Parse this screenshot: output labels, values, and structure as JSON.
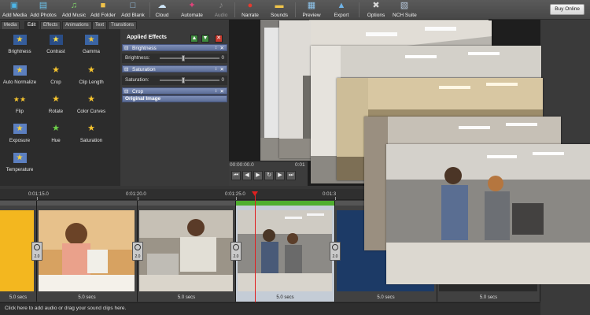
{
  "toolbar": {
    "add_media": "Add Media",
    "add_photos": "Add Photos",
    "add_music": "Add Music",
    "add_folder": "Add Folder",
    "add_blank": "Add Blank",
    "cloud": "Cloud",
    "automate": "Automate",
    "audio": "Audio",
    "narrate": "Narrate",
    "sounds": "Sounds",
    "preview": "Preview",
    "export": "Export",
    "options": "Options",
    "nch_suite": "NCH Suite",
    "buy_online": "Buy Online"
  },
  "tabs": [
    "Media",
    "Edit",
    "Effects",
    "Animations",
    "Text",
    "Transitions"
  ],
  "effects": {
    "brightness": "Brightness",
    "contrast": "Contrast",
    "gamma": "Gamma",
    "auto_normalize": "Auto Normalize",
    "crop": "Crop",
    "clip_length": "Clip Length",
    "flip": "Flip",
    "rotate": "Rotate",
    "color_curves": "Color Curves",
    "exposure": "Exposure",
    "hue": "Hue",
    "saturation": "Saturation",
    "temperature": "Temperature"
  },
  "applied_effects": {
    "title": "Applied Effects",
    "brightness": {
      "name": "Brightness",
      "param": "Brightness:",
      "value": "0"
    },
    "saturation": {
      "name": "Saturation",
      "param": "Saturation:",
      "value": "0"
    },
    "crop": {
      "name": "Crop"
    },
    "original": "Original Image"
  },
  "preview": {
    "time": "00:00:00.0",
    "time_end": "0:01"
  },
  "timeline": {
    "ticks": [
      "0:01:15.0",
      "0:01:20.0",
      "0:01:25.0",
      "0:01:3"
    ],
    "clips": [
      {
        "duration": "5.0 secs"
      },
      {
        "duration": "5.0 secs"
      },
      {
        "duration": "5.0 secs"
      },
      {
        "duration": "5.0 secs"
      },
      {
        "duration": "5.0 secs"
      }
    ],
    "transition_value": "2.0",
    "audio_hint": "Click here to add audio or drag your sound clips here."
  },
  "colors": {
    "selection_green": "#4fae2f",
    "playhead_red": "#e02020",
    "effect_bar_blue": "#6b7ca6"
  }
}
